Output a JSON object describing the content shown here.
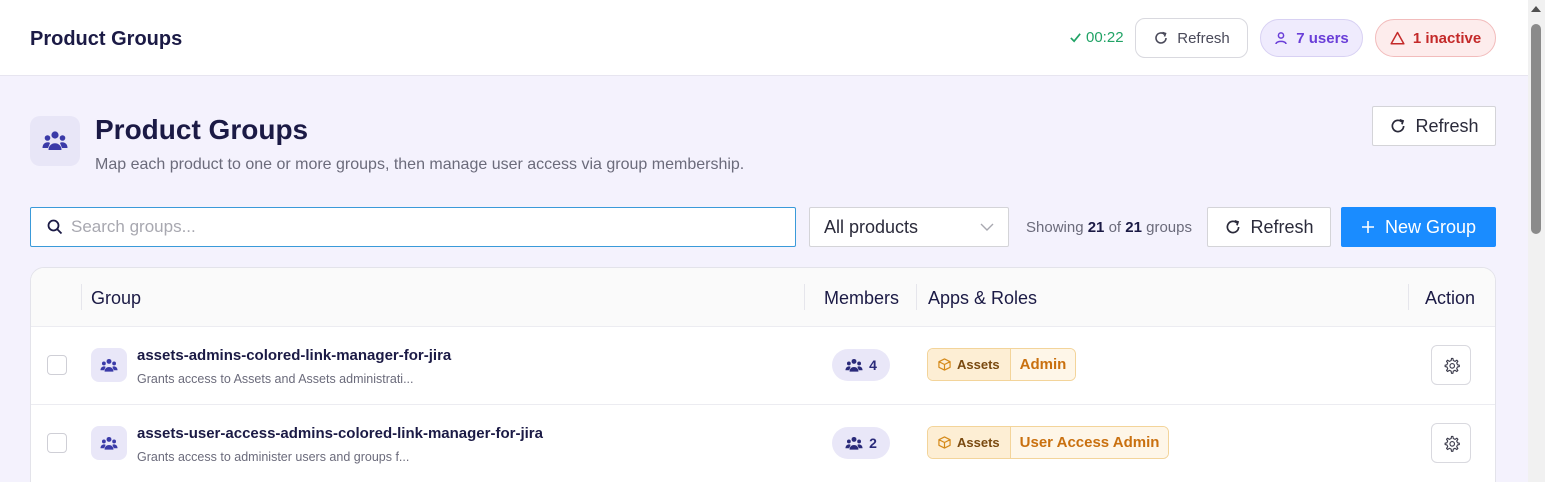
{
  "topbar": {
    "title": "Product Groups",
    "timer": "00:22",
    "refresh_label": "Refresh",
    "users_label": "7 users",
    "inactive_label": "1 inactive"
  },
  "header": {
    "title": "Product Groups",
    "subtitle": "Map each product to one or more groups, then manage user access via group membership.",
    "refresh_label": "Refresh"
  },
  "toolbar": {
    "search_placeholder": "Search groups...",
    "search_value": "",
    "product_filter": "All products",
    "showing_prefix": "Showing",
    "showing_count": "21",
    "showing_of": "of",
    "showing_total": "21",
    "showing_suffix": "groups",
    "refresh_label": "Refresh",
    "new_group_label": "New Group"
  },
  "table": {
    "columns": [
      "Group",
      "Members",
      "Apps & Roles",
      "Action"
    ],
    "rows": [
      {
        "name": "assets-admins-colored-link-manager-for-jira",
        "description": "Grants access to Assets and Assets administrati...",
        "members": "4",
        "app": "Assets",
        "role": "Admin"
      },
      {
        "name": "assets-user-access-admins-colored-link-manager-for-jira",
        "description": "Grants access to administer users and groups f...",
        "members": "2",
        "app": "Assets",
        "role": "User Access Admin"
      }
    ]
  },
  "colors": {
    "accent": "#1a8cff",
    "success": "#21a366",
    "users_pill": "#6a3ed8",
    "inactive_pill": "#c42929",
    "app_tag": "#c9700f"
  },
  "icons": {
    "timer": "check-icon",
    "refresh": "refresh-icon",
    "users": "user-icon",
    "inactive": "warning-triangle-icon",
    "page": "users-group-icon",
    "search": "search-icon",
    "select": "chevron-down-icon",
    "new": "plus-icon",
    "app": "box-icon",
    "action": "gear-icon"
  }
}
